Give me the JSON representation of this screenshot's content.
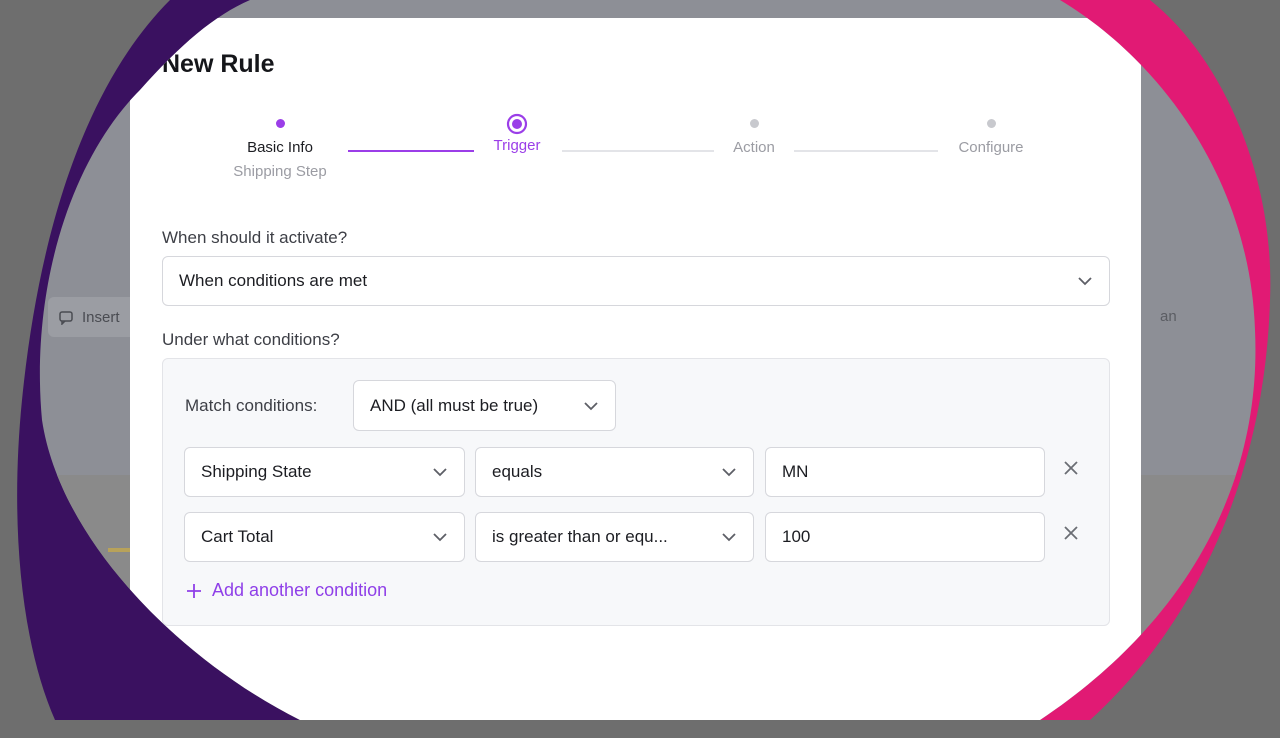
{
  "background": {
    "ghost_button_label": "Insert",
    "ghost_text": "an"
  },
  "colors": {
    "accent": "#9b3ee8",
    "muted": "#c8c9ce",
    "purple_blob": "#3a1160",
    "pink_blob": "#e11a74"
  },
  "modal": {
    "title": "New Rule",
    "steps": [
      {
        "label": "Basic Info",
        "sublabel": "Shipping Step",
        "state": "complete"
      },
      {
        "label": "Trigger",
        "sublabel": "",
        "state": "current"
      },
      {
        "label": "Action",
        "sublabel": "",
        "state": "upcoming"
      },
      {
        "label": "Configure",
        "sublabel": "",
        "state": "upcoming"
      }
    ],
    "activation": {
      "question": "When should it activate?",
      "selected": "When conditions are met"
    },
    "conditions": {
      "question": "Under what conditions?",
      "match_label": "Match conditions:",
      "match_selected": "AND (all must be true)",
      "rows": [
        {
          "field": "Shipping State",
          "operator": "equals",
          "value": "MN"
        },
        {
          "field": "Cart Total",
          "operator": "is greater than or equ...",
          "value": "100"
        }
      ],
      "add_label": "Add another condition"
    }
  }
}
